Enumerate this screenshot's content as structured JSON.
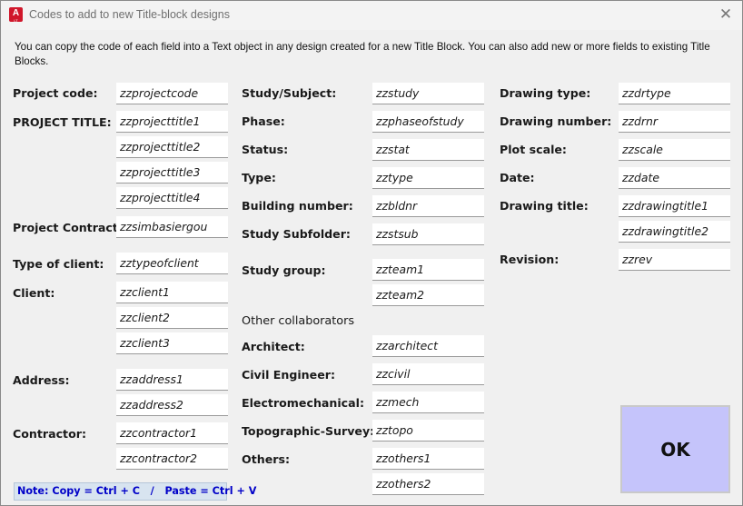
{
  "window": {
    "title": "Codes to add to new Title-block designs",
    "app_icon_letter": "A",
    "app_icon_sub": "LT"
  },
  "intro": "You can copy the code of each field into a Text object in any design created for a new Title Block. You can also add new or more fields to existing Title Blocks.",
  "labels": {
    "project_code": "Project code:",
    "project_title": "PROJECT TITLE:",
    "project_contract": "Project Contract:",
    "type_of_client": "Type of client:",
    "client": "Client:",
    "address": "Address:",
    "contractor": "Contractor:",
    "study_subject": "Study/Subject:",
    "phase": "Phase:",
    "status": "Status:",
    "type": "Type:",
    "building_number": "Building number:",
    "study_subfolder": "Study Subfolder:",
    "study_group": "Study group:",
    "other_collaborators": "Other collaborators",
    "architect": "Architect:",
    "civil_engineer": "Civil Engineer:",
    "electromechanical": "Electromechanical:",
    "topographic_survey": "Topographic-Survey:",
    "others": "Others:",
    "drawing_type": "Drawing type:",
    "drawing_number": "Drawing number:",
    "plot_scale": "Plot scale:",
    "date": "Date:",
    "drawing_title": "Drawing title:",
    "revision": "Revision:"
  },
  "codes": {
    "project_code": "zzprojectcode",
    "project_title_1": "zzprojecttitle1",
    "project_title_2": "zzprojecttitle2",
    "project_title_3": "zzprojecttitle3",
    "project_title_4": "zzprojecttitle4",
    "project_contract": "zzsimbasiergou",
    "type_of_client": "zztypeofclient",
    "client_1": "zzclient1",
    "client_2": "zzclient2",
    "client_3": "zzclient3",
    "address_1": "zzaddress1",
    "address_2": "zzaddress2",
    "contractor_1": "zzcontractor1",
    "contractor_2": "zzcontractor2",
    "study_subject": "zzstudy",
    "phase": "zzphaseofstudy",
    "status": "zzstat",
    "type": "zztype",
    "building_number": "zzbldnr",
    "study_subfolder": "zzstsub",
    "study_group_1": "zzteam1",
    "study_group_2": "zzteam2",
    "architect": "zzarchitect",
    "civil_engineer": "zzcivil",
    "electromechanical": "zzmech",
    "topographic_survey": "zztopo",
    "others_1": "zzothers1",
    "others_2": "zzothers2",
    "drawing_type": "zzdrtype",
    "drawing_number": "zzdrnr",
    "plot_scale": "zzscale",
    "date": "zzdate",
    "drawing_title_1": "zzdrawingtitle1",
    "drawing_title_2": "zzdrawingtitle2",
    "revision": "zzrev"
  },
  "note": "Note: Copy = Ctrl + C   /   Paste = Ctrl + V",
  "ok_label": "OK",
  "colors": {
    "ok_button": "#c5c4fb",
    "note_text": "#0000c8",
    "note_background": "#d8e4f0",
    "app_icon": "#d0172b"
  }
}
